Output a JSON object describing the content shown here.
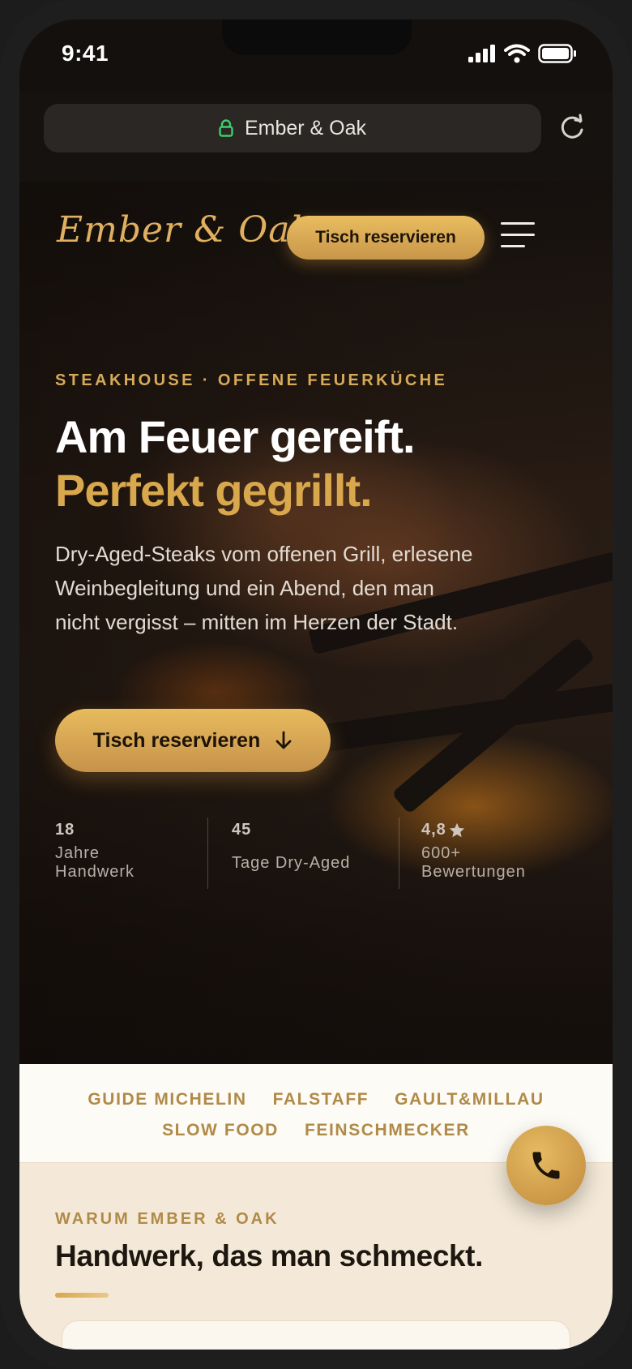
{
  "status_bar": {
    "time": "9:41"
  },
  "browser": {
    "url_label": "Ember & Oak"
  },
  "nav": {
    "logo": "Ember & Oak",
    "reserve_label": "Tisch reservieren"
  },
  "hero": {
    "eyebrow": "STEAKHOUSE · OFFENE FEUERKÜCHE",
    "headline_line1": "Am Feuer gereift.",
    "headline_line2": "Perfekt gegrillt.",
    "lead": "Dry-Aged-Steaks vom offenen Grill, erlesene Weinbegleitung und ein Abend, den man nicht vergisst – mitten im Herzen der Stadt.",
    "cta_label": "Tisch reservieren"
  },
  "stats": [
    {
      "value": "18",
      "label_line1": "Jahre",
      "label_line2": "Handwerk"
    },
    {
      "value": "45",
      "label_line1": "Tage Dry-Aged",
      "label_line2": ""
    },
    {
      "value": "4,8",
      "label_line1": "600+",
      "label_line2": "Bewertungen"
    }
  ],
  "press": {
    "row1": [
      "GUIDE MICHELIN",
      "FALSTAFF",
      "GAULT&MILLAU"
    ],
    "row2": [
      "SLOW FOOD",
      "FEINSCHMECKER"
    ]
  },
  "why": {
    "eyebrow": "WARUM EMBER & OAK",
    "title": "Handwerk, das man schmeckt."
  },
  "colors": {
    "accent_gold": "#d9a74c",
    "dark_bg": "#14100d",
    "cream": "#f4e9d8",
    "press_text": "#b08a47"
  },
  "icons": [
    "lock-icon",
    "reload-icon",
    "menu-icon",
    "arrow-down-icon",
    "star-icon",
    "phone-icon",
    "signal-icon",
    "wifi-icon",
    "battery-icon"
  ]
}
